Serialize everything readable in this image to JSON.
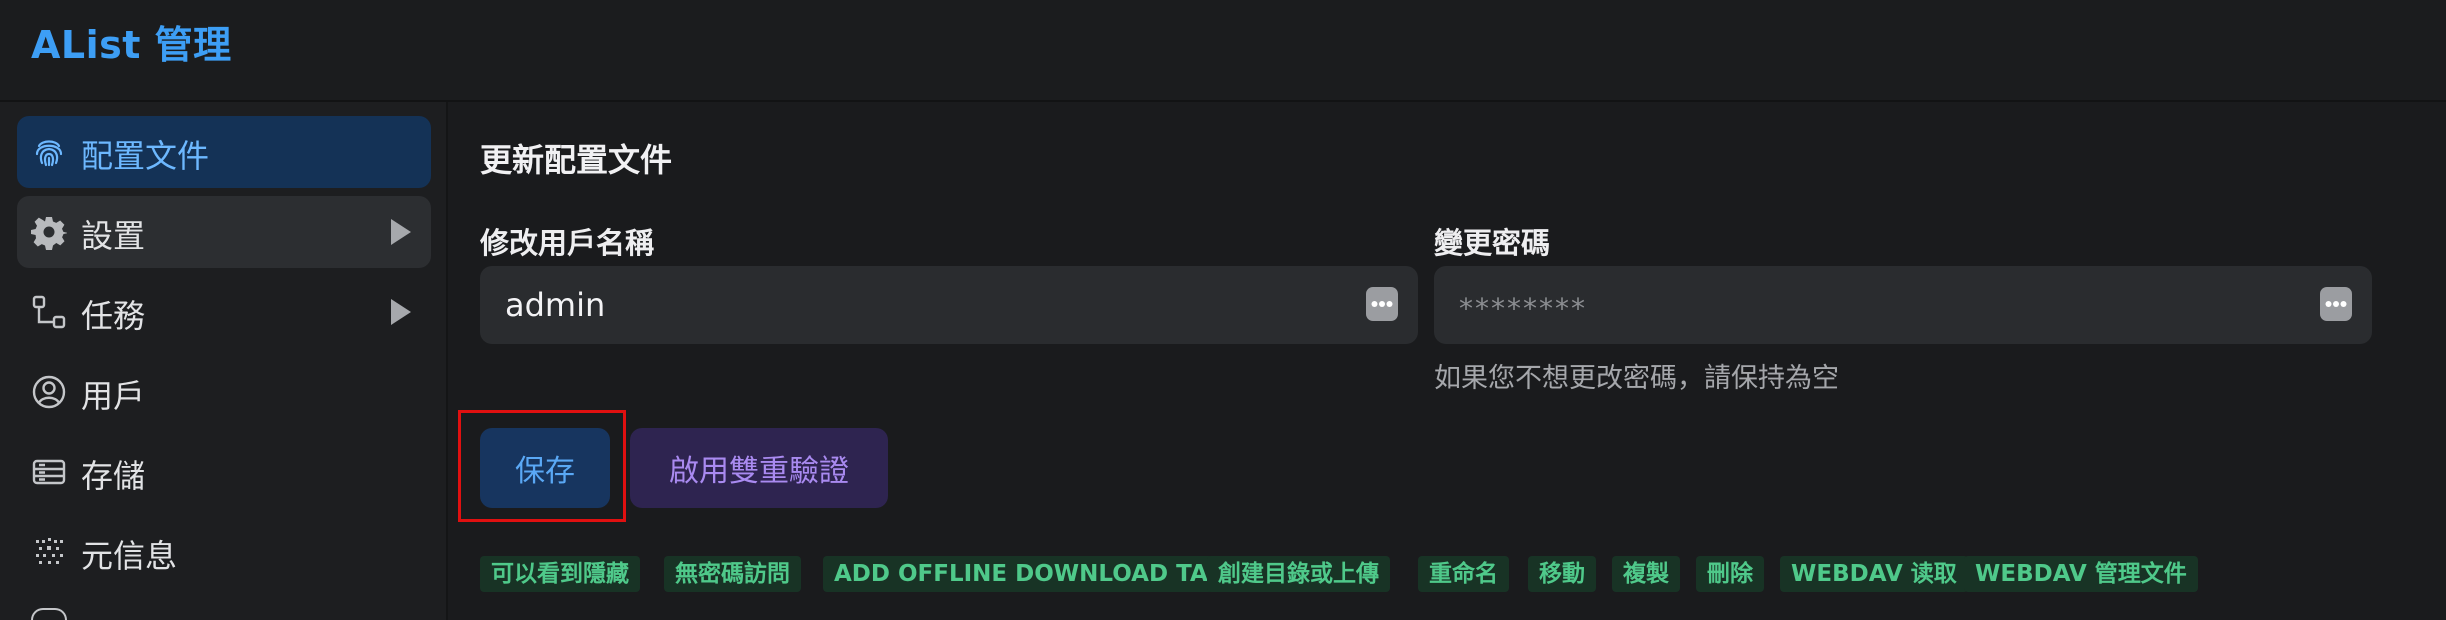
{
  "app": {
    "title": "AList 管理"
  },
  "sidebar": {
    "items": [
      {
        "label": "配置文件",
        "icon": "fingerprint-icon",
        "active": true
      },
      {
        "label": "設置",
        "icon": "gear-icon",
        "expandable": true
      },
      {
        "label": "任務",
        "icon": "flow-icon",
        "expandable": true
      },
      {
        "label": "用戶",
        "icon": "user-circle-icon"
      },
      {
        "label": "存儲",
        "icon": "storage-icon"
      },
      {
        "label": "元信息",
        "icon": "meta-icon"
      }
    ]
  },
  "main": {
    "section_title": "更新配置文件",
    "username": {
      "label": "修改用戶名稱",
      "value": "admin"
    },
    "password": {
      "label": "變更密碼",
      "placeholder": "********",
      "helper": "如果您不想更改密碼，請保持為空"
    },
    "buttons": {
      "save": "保存",
      "enable_2fa": "啟用雙重驗證"
    },
    "permissions": [
      "可以看到隱藏",
      "無密碼訪問",
      "ADD OFFLINE DOWNLOAD TASKS",
      "創建目錄或上傳",
      "重命名",
      "移動",
      "複製",
      "刪除",
      "WEBDAV 读取",
      "WEBDAV 管理文件"
    ]
  },
  "colors": {
    "accent": "#3d9ef5",
    "active_bg": "#143256",
    "tag_bg": "#183325",
    "tag_text": "#4fc98a",
    "highlight": "#e01010"
  }
}
